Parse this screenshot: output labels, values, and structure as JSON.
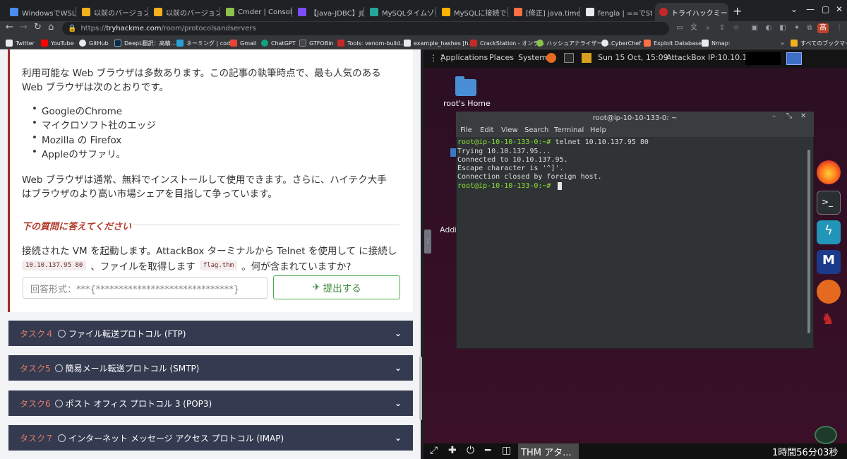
{
  "browser": {
    "tabs": [
      {
        "title": "WindowsでWSL2を",
        "color": "#4a8cf0"
      },
      {
        "title": "以前のバージョンの V",
        "color": "#f2b01e"
      },
      {
        "title": "以前のバージョンの V",
        "color": "#f2b01e"
      },
      {
        "title": "Cmder | Console E",
        "color": "#8bc34a"
      },
      {
        "title": "【Java-JDBC】JDBC",
        "color": "#7c4dff"
      },
      {
        "title": "MySQLタイムゾーン",
        "color": "#26a69a"
      },
      {
        "title": "MySQLに接続できない",
        "color": "#ffb300"
      },
      {
        "title": "[修正] java.time.zo",
        "color": "#ff7043"
      },
      {
        "title": "fengla | ==でStrin",
        "color": "#e8eaed"
      },
      {
        "title": "トライハックミー | プロ",
        "color": "#c62828"
      }
    ],
    "new_tab": "+",
    "window_controls": [
      "⌄",
      "—",
      "▢",
      "✕"
    ],
    "url_host": "tryhackme.com",
    "url_full": "https://tryhackme.com/room/protocolsandservers",
    "url_prefix": "https://",
    "url_path": "/room/protocolsandservers",
    "bookmarks": [
      {
        "label": "Twitter",
        "color": "#e8eaed"
      },
      {
        "label": "YouTube",
        "color": "#ff0000"
      },
      {
        "label": "GitHub",
        "color": "#e8eaed"
      },
      {
        "label": "DeepL翻訳：高精...",
        "color": "#0f2b46"
      },
      {
        "label": "ネーミング | codic",
        "color": "#2aa0d8"
      },
      {
        "label": "Gmail",
        "color": "#ea4335"
      },
      {
        "label": "ChatGPT",
        "color": "#10a37f"
      },
      {
        "label": "GTFOBin",
        "color": "#444"
      },
      {
        "label": "Tools: venom-build...",
        "color": "#c62828"
      },
      {
        "label": "example_hashes [h...",
        "color": "#e8eaed"
      },
      {
        "label": "CrackStation - オンラ...",
        "color": "#c62828"
      },
      {
        "label": "ハッシュアナライザー -...",
        "color": "#8bc34a"
      },
      {
        "label": "CyberChef",
        "color": "#e8eaed"
      },
      {
        "label": "Exploit Database",
        "color": "#ff7043"
      },
      {
        "label": "Nmap:",
        "color": "#e8eaed"
      }
    ],
    "all_bookmarks": "すべてのブックマーク"
  },
  "content": {
    "para1_line1": "利用可能な Web ブラウザは多数あります。この記事の執筆時点で、最も人気のある",
    "para1_line2": "Web ブラウザは次のとおりです。",
    "list": [
      "GoogleのChrome",
      "マイクロソフト社のエッジ",
      "Mozilla の Firefox",
      "Appleのサファリ。"
    ],
    "para2_line1": "Web ブラウザは通常、無料でインストールして使用できます。さらに、ハイテク大手",
    "para2_line2": "はブラウザのより高い市場シェアを目指して争っています。",
    "question_header": "下の質問に答えてください",
    "question_line1": "接続された VM を起動します。AttackBox ターミナルから Telnet を使用して に接続し",
    "question_code1": "10.10.137.95 80",
    "question_mid": "、ファイルを取得します",
    "question_code2": "flag.thm",
    "question_end": "。何が含まれていますか?",
    "answer_placeholder": "回答形式：***{******************************}",
    "submit_label": "提出する"
  },
  "tasks": [
    {
      "num": "タスク４",
      "name": "ファイル転送プロトコル (FTP)"
    },
    {
      "num": "タスク5",
      "name": "簡易メール転送プロトコル (SMTP)"
    },
    {
      "num": "タスク6",
      "name": "ポスト オフィス プロトコル 3 (POP3)"
    },
    {
      "num": "タスク７",
      "name": "インターネット メッセージ アクセス プロトコル (IMAP)"
    }
  ],
  "attackbox": {
    "menu": [
      "Applications",
      "Places",
      "System"
    ],
    "clock": "Sun 15 Oct, 15:09",
    "ip_label": "AttackBox IP:10.10.133.0",
    "home_label": "root's Home",
    "addi_label": "Addi",
    "terminal": {
      "title": "root@ip-10-10-133-0: ~",
      "menu": [
        "File",
        "Edit",
        "View",
        "Search",
        "Terminal",
        "Help"
      ],
      "prompt": "root@ip-10-10-133-0:~#",
      "command": " telnet 10.10.137.95 80",
      "output": [
        "Trying 10.10.137.95...",
        "Connected to 10.10.137.95.",
        "Escape character is '^]'.",
        "Connection closed by foreign host."
      ],
      "prompt2": "root@ip-10-10-133-0:~#"
    },
    "thm_tab": "THM アタ...",
    "timer": "1時間56分03秒"
  }
}
